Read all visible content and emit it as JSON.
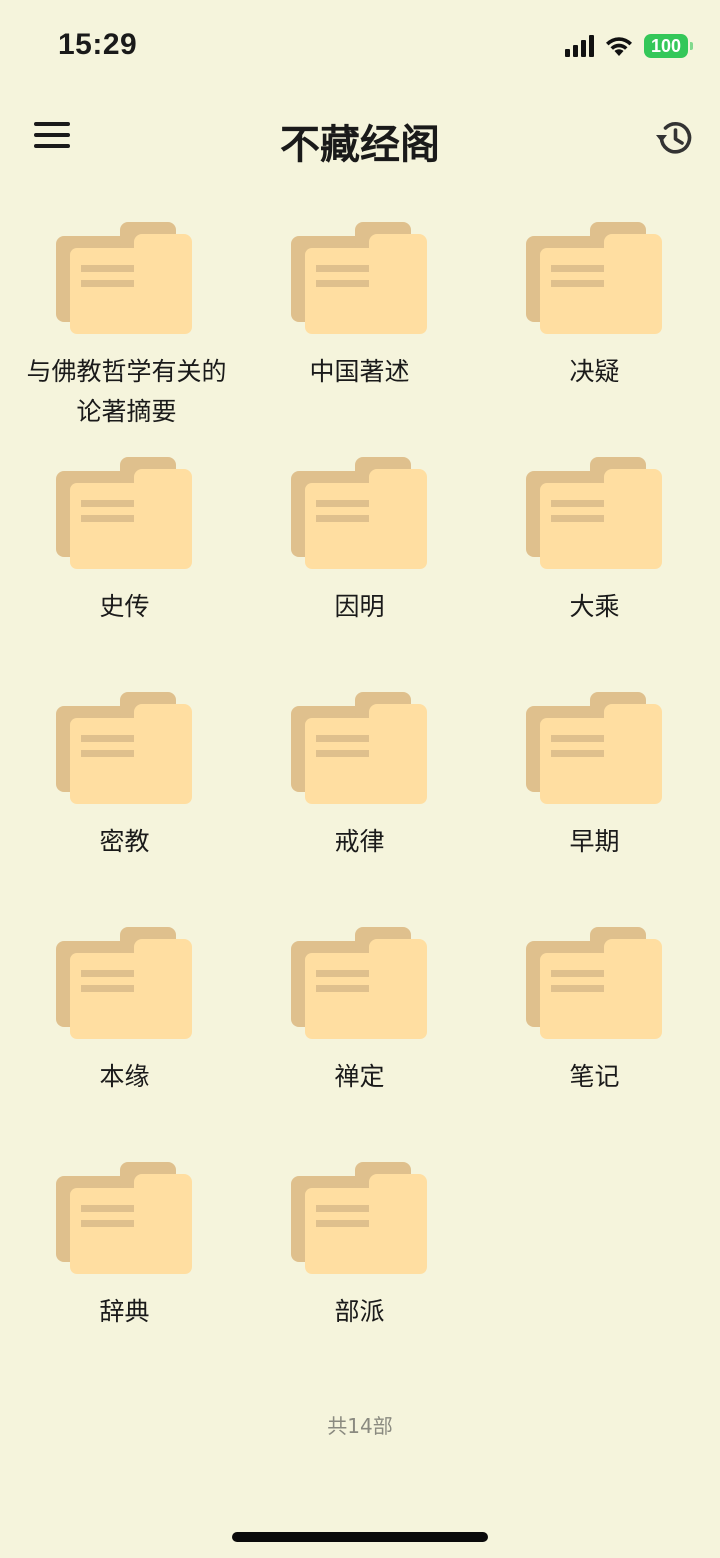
{
  "status_bar": {
    "time": "15:29",
    "battery": "100"
  },
  "nav": {
    "title": "不藏经阁",
    "menu_icon": "hamburger-menu-icon",
    "history_icon": "history-clock-icon"
  },
  "colors": {
    "background": "#F5F4DC",
    "folder_back": "#DFC08D",
    "folder_front": "#FFDEA1",
    "folder_lines": "#DFC08D",
    "battery": "#34C759"
  },
  "categories": [
    {
      "label": "与佛教哲学有关的论著摘要"
    },
    {
      "label": "中国著述"
    },
    {
      "label": "决疑"
    },
    {
      "label": "史传"
    },
    {
      "label": "因明"
    },
    {
      "label": "大乘"
    },
    {
      "label": "密教"
    },
    {
      "label": "戒律"
    },
    {
      "label": "早期"
    },
    {
      "label": "本缘"
    },
    {
      "label": "禅定"
    },
    {
      "label": "笔记"
    },
    {
      "label": "辞典"
    },
    {
      "label": "部派"
    }
  ],
  "footer": {
    "count_text": "共14部"
  }
}
